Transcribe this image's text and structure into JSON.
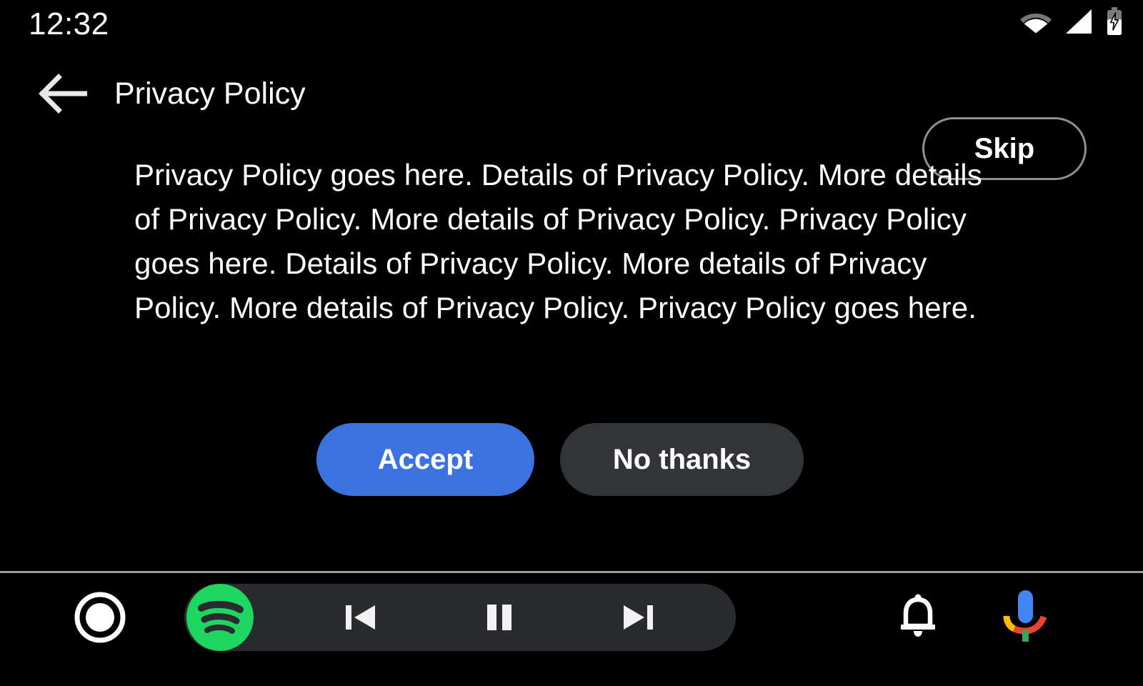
{
  "status_bar": {
    "clock": "12:32",
    "icons": [
      {
        "name": "wifi-icon",
        "label": "Wi-Fi"
      },
      {
        "name": "cellular-signal-icon",
        "label": "Cellular signal"
      },
      {
        "name": "battery-charging-icon",
        "label": "Battery charging"
      }
    ]
  },
  "header": {
    "back_label": "Back",
    "title": "Privacy Policy",
    "skip_label": "Skip"
  },
  "main": {
    "policy_text": "Privacy Policy goes here. Details of Privacy Policy. More details of Privacy Policy. More details of Privacy Policy. Privacy Policy goes here. Details of Privacy Policy. More details of Privacy Policy. More details of Privacy Policy. Privacy Policy goes here.",
    "accept_label": "Accept",
    "no_thanks_label": "No thanks"
  },
  "bottom_bar": {
    "home_label": "Home",
    "media_app": "Spotify",
    "previous_label": "Previous track",
    "play_pause_label": "Pause",
    "next_label": "Next track",
    "notifications_label": "Notifications",
    "assistant_label": "Google Assistant"
  },
  "colors": {
    "background": "#000000",
    "accent_blue": "#3b72e0",
    "secondary_button": "#333438",
    "media_pill": "#2a2b2e",
    "spotify_green": "#1ed760",
    "divider": "#9a9a9a",
    "outline_gray": "#8f8f8f",
    "text_primary": "#ffffff"
  }
}
